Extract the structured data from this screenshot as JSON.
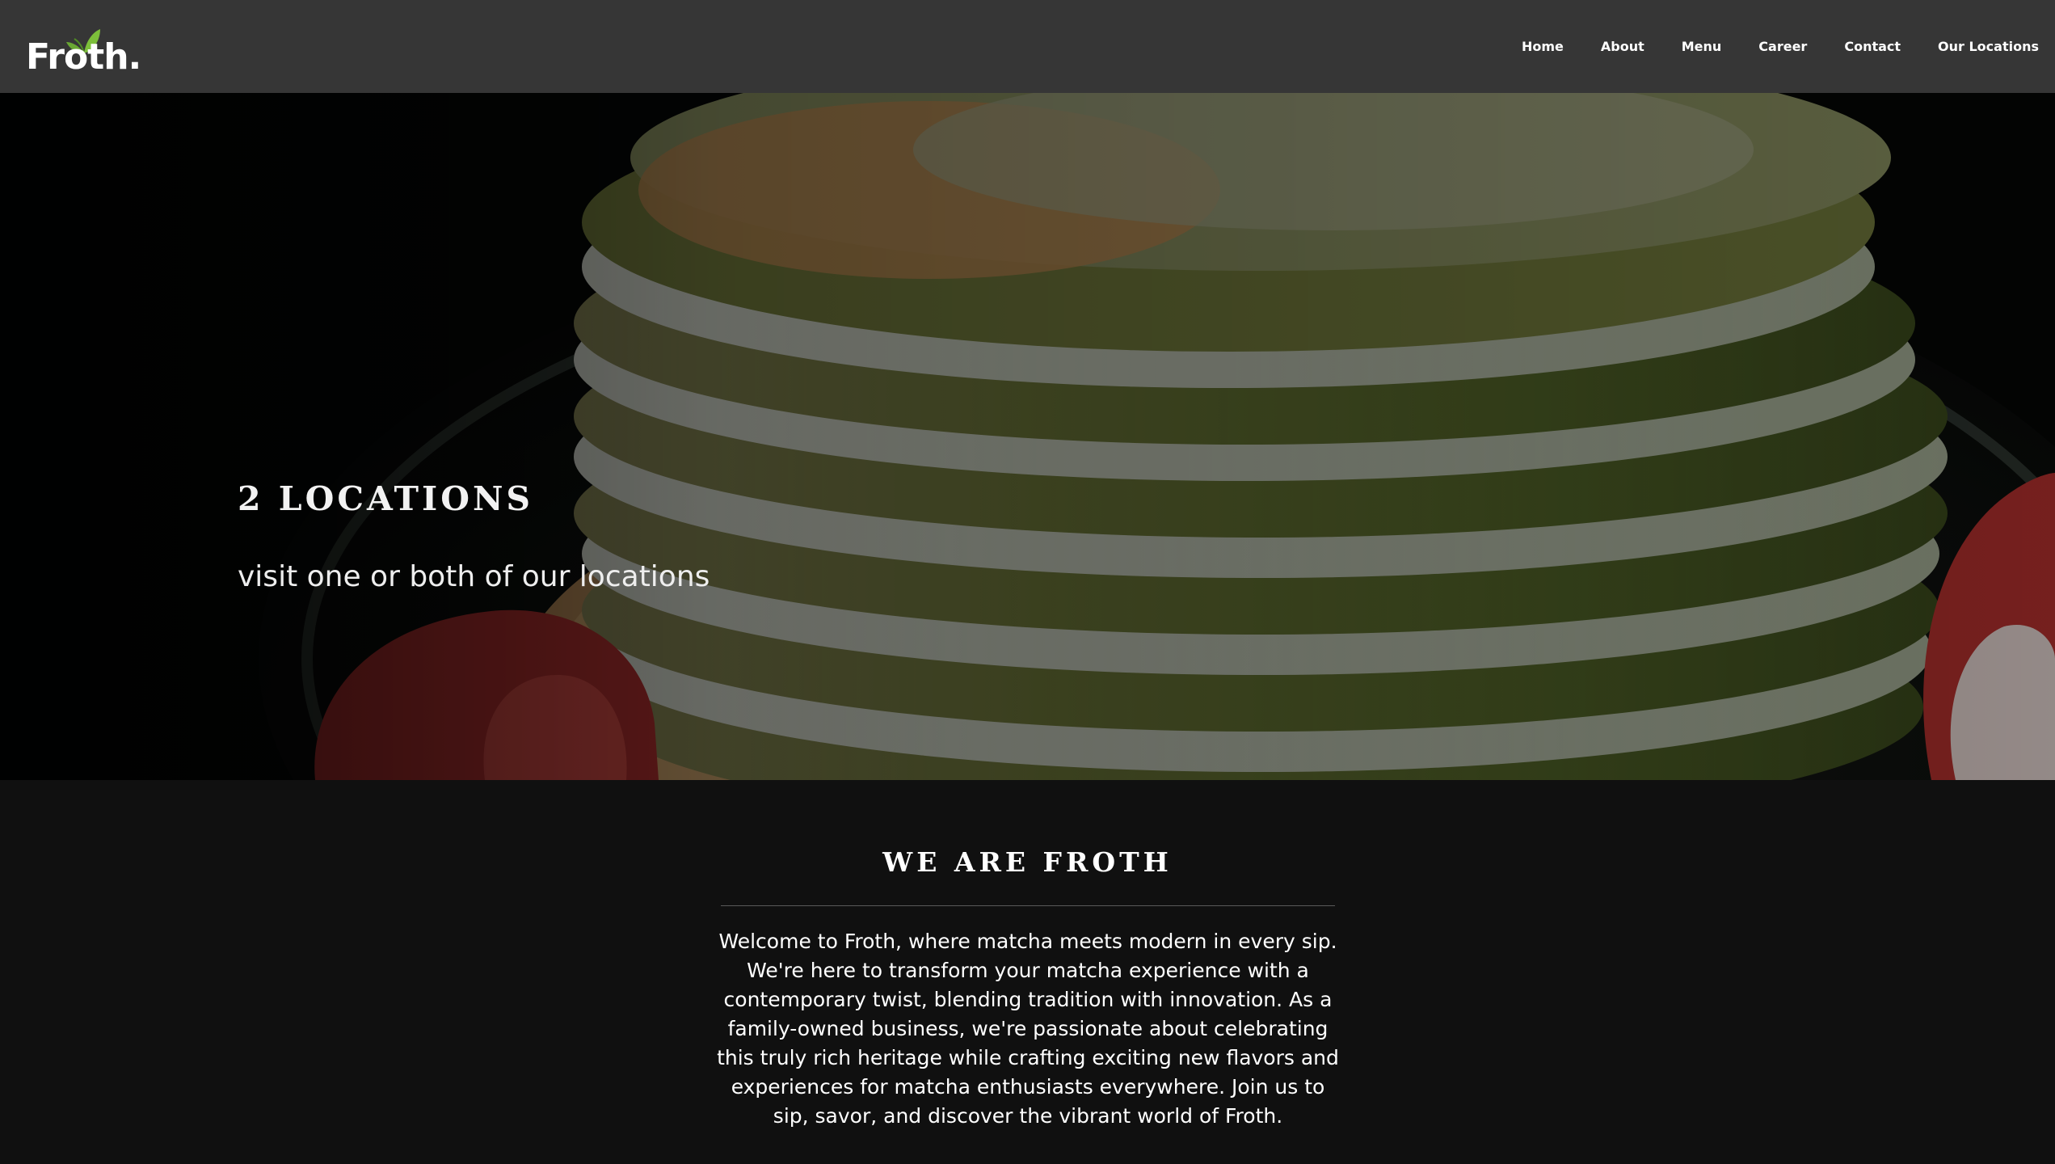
{
  "brand": {
    "name": "Froth.",
    "logo_icon": "leaf-icon",
    "accent_color": "#6aa833"
  },
  "nav": {
    "items": [
      {
        "label": "Home"
      },
      {
        "label": "About"
      },
      {
        "label": "Menu"
      },
      {
        "label": "Career"
      },
      {
        "label": "Contact"
      },
      {
        "label": "Our Locations"
      }
    ]
  },
  "hero": {
    "title": "2 LOCATIONS",
    "subtitle": "visit one or both of our locations",
    "image": "matcha-pancakes-with-strawberries"
  },
  "about": {
    "title": "WE ARE FROTH",
    "body": "Welcome to Froth, where matcha meets modern in every sip. We're here to transform your matcha experience with a contemporary twist, blending tradition with innovation. As a family-owned business, we're passionate about celebrating this truly rich heritage while crafting exciting new flavors and experiences for matcha enthusiasts everywhere. Join us to sip, savor, and discover the vibrant world of Froth."
  },
  "colors": {
    "header_bg": "#363636",
    "page_bg": "#101010",
    "text": "#ffffff"
  }
}
